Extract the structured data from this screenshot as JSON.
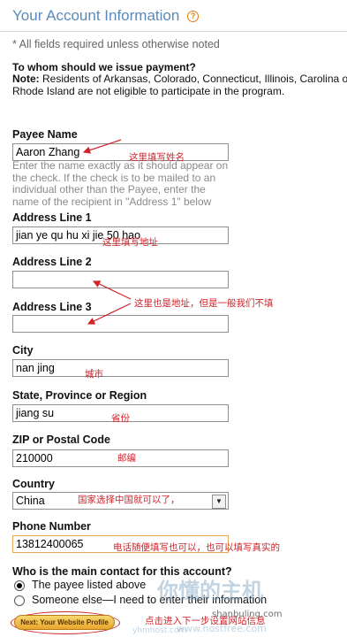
{
  "page": {
    "title": "Your Account Information",
    "required_note": "* All fields required unless otherwise noted",
    "payment_question": "To whom should we issue payment?",
    "note_label": "Note:",
    "note_text": " Residents of Arkansas, Colorado, Connecticut, Illinois, Carolina or Rhode Island are not eligible to participate in the program."
  },
  "form": {
    "payee_name": {
      "label": "Payee Name",
      "value": "Aaron Zhang",
      "help": "Enter the name exactly as it should appear on the check. If the check is to be mailed to an individual other than the Payee, enter the name of the recipient in \"Address 1\" below"
    },
    "address1": {
      "label": "Address Line 1",
      "value": "jian ye qu hu xi jie 50 hao"
    },
    "address2": {
      "label": "Address Line 2",
      "value": ""
    },
    "address3": {
      "label": "Address Line 3",
      "value": ""
    },
    "city": {
      "label": "City",
      "value": "nan jing"
    },
    "state": {
      "label": "State, Province or Region",
      "value": "jiang su"
    },
    "zip": {
      "label": "ZIP or Postal Code",
      "value": "210000"
    },
    "country": {
      "label": "Country",
      "value": "China"
    },
    "phone": {
      "label": "Phone Number",
      "value": "13812400065"
    },
    "contact": {
      "question": "Who is the main contact for this account?",
      "options": [
        {
          "label": "The payee listed above",
          "checked": true
        },
        {
          "label": "Someone else—I need to enter their information",
          "checked": false
        }
      ]
    },
    "next_button": "Next: Your Website Profile"
  },
  "annotations": {
    "name": "这里填写姓名",
    "address": "这里填写地址",
    "address_extra": "这里也是地址，但是一般我们不填",
    "city": "城市",
    "province": "省份",
    "zip": "邮编",
    "country": "国家选择中国就可以了，",
    "phone": "电话随便填写也可以，也可以填写真实的",
    "next": "点击进入下一步设置网站信息"
  },
  "watermark": {
    "brand": "你懂的主机",
    "url": "www.hostfree.com",
    "site": "shanbuling.com",
    "overlay": "yhmhost.com"
  },
  "colors": {
    "title": "#5b8ab8",
    "annotation": "#d1232a",
    "button_gradient_top": "#f8d66f",
    "button_gradient_bottom": "#e9a62b"
  },
  "icons": [
    "help-icon",
    "dropdown-arrow-icon",
    "annotation-arrow-icon"
  ]
}
